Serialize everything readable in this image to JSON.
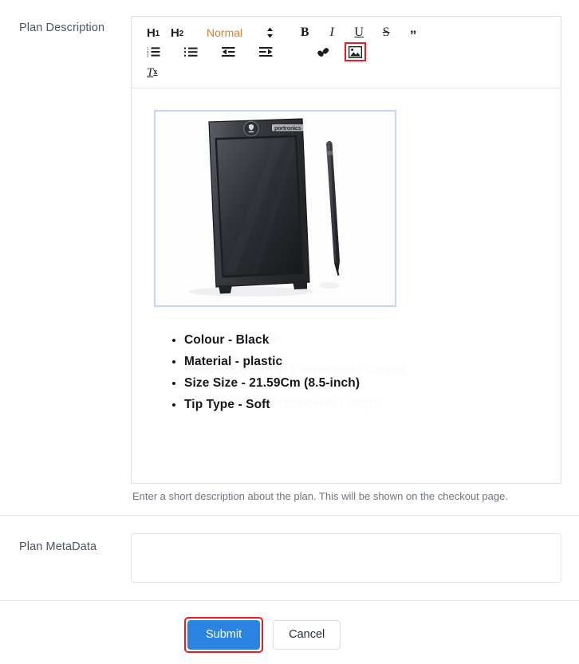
{
  "form": {
    "description_label": "Plan Description",
    "metadata_label": "Plan MetaData",
    "description_help": "Enter a short description about the plan. This will be shown on the checkout page.",
    "metadata_value": "",
    "metadata_placeholder": ""
  },
  "editor": {
    "toolbar": {
      "h1": "H",
      "h1_sub": "1",
      "h2": "H",
      "h2_sub": "2",
      "format_select": "Normal",
      "bold": "B",
      "italic": "I",
      "underline": "U",
      "strike": "S",
      "blockquote": "”",
      "clear_format": "T",
      "clear_format_sub": "x",
      "ordered_list_name": "ordered-list-icon",
      "bullet_list_name": "bullet-list-icon",
      "outdent_name": "outdent-icon",
      "indent_name": "indent-icon",
      "link_name": "link-icon",
      "image_name": "image-icon"
    },
    "content": {
      "image_alt": "Black LCD writing tablet with stylus pen",
      "image_selected": true,
      "bullets": [
        "Colour - Black",
        "Material - plastic",
        "Size Size - 21.59Cm (8.5-inch)",
        "Tip Type - Soft"
      ],
      "ghost_bullets": [
        "Fit Type: Athletic",
        "Made With Soft & Comfortable Cotton",
        "Regular Fit Trackpant Full Length"
      ]
    }
  },
  "actions": {
    "submit_label": "Submit",
    "cancel_label": "Cancel"
  },
  "colors": {
    "highlight": "#ee1c23",
    "primary_button": "#2b84e0",
    "select_text": "#d98026",
    "image_selection": "#c3d7fa"
  }
}
